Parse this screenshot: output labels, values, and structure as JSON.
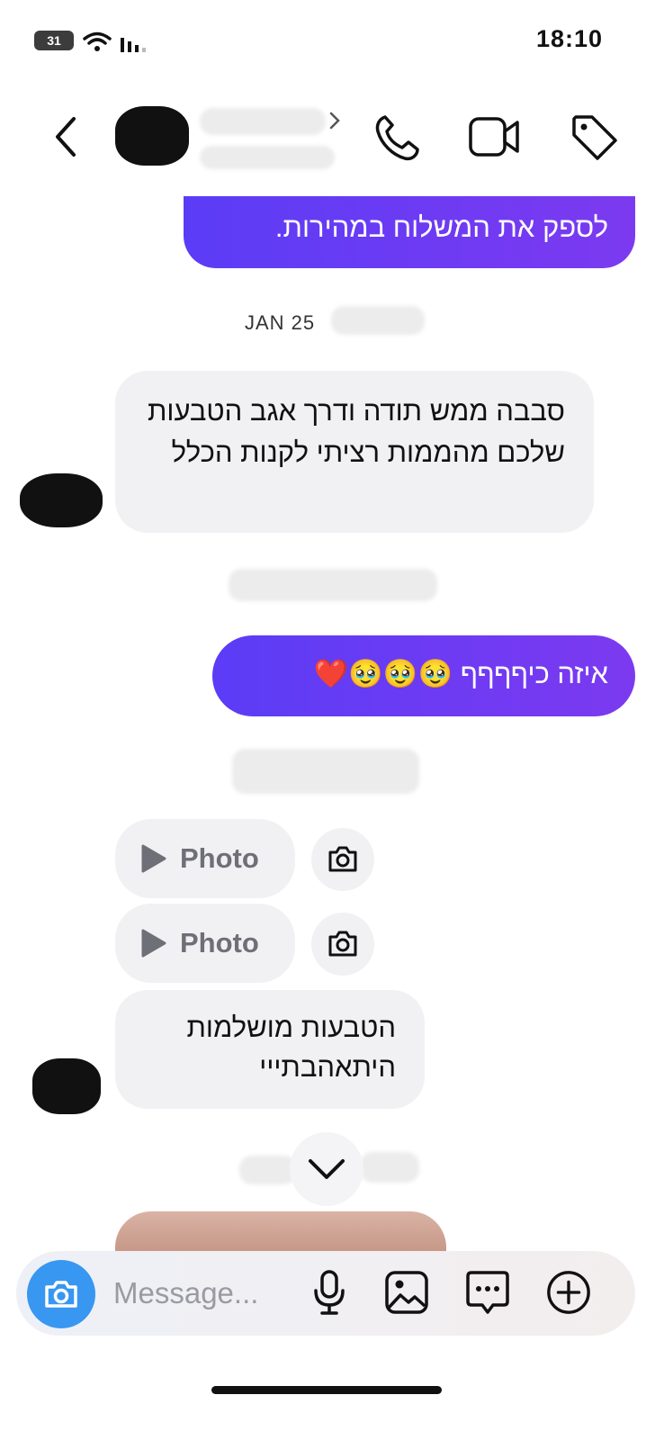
{
  "status_bar": {
    "time": "18:10",
    "battery": "31"
  },
  "header": {
    "icons": [
      "back-chevron-icon",
      "phone-icon",
      "video-camera-icon",
      "tag-icon"
    ]
  },
  "messages": {
    "outgoing_top": "לספק את המשלוח במהירות.",
    "date_label": "JAN 25",
    "incoming_1": "סבבה ממש תודה ודרך אגב הטבעות שלכם מהממות רציתי לקנות הכלל",
    "outgoing_2": "איזה כיףףףף 🥹🥹🥹❤️",
    "photo_1_label": "Photo",
    "photo_2_label": "Photo",
    "incoming_2": "הטבעות מושלמות היתאהבתייי"
  },
  "composer": {
    "placeholder": "Message..."
  },
  "colors": {
    "outgoing_gradient_start": "#5b3cf6",
    "outgoing_gradient_end": "#7c3af0",
    "incoming_bg": "#f1f1f3",
    "camera_button": "#3897f0"
  }
}
